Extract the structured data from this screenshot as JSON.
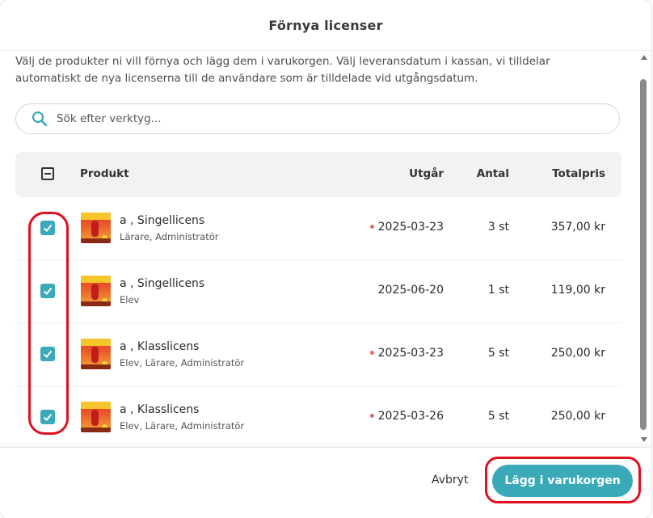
{
  "modal": {
    "title": "Förnya licenser",
    "intro": "Välj de produkter ni vill förnya och lägg dem i varukorgen. Välj leveransdatum i kassan, vi tilldelar automatiskt de nya licenserna till de användare som är tilldelade vid utgångsdatum."
  },
  "search": {
    "placeholder": "Sök efter verktyg..."
  },
  "table": {
    "headers": {
      "product": "Produkt",
      "expires": "Utgår",
      "quantity": "Antal",
      "total": "Totalpris"
    },
    "rows": [
      {
        "name": "a , Singellicens",
        "roles": "Lärare, Administratör",
        "expires": "2025-03-23",
        "expiring_soon": true,
        "quantity": "3 st",
        "price": "357,00 kr",
        "checked": true
      },
      {
        "name": "a , Singellicens",
        "roles": "Elev",
        "expires": "2025-06-20",
        "expiring_soon": false,
        "quantity": "1 st",
        "price": "119,00 kr",
        "checked": true
      },
      {
        "name": "a , Klasslicens",
        "roles": "Elev, Lärare, Administratör",
        "expires": "2025-03-23",
        "expiring_soon": true,
        "quantity": "5 st",
        "price": "250,00 kr",
        "checked": true
      },
      {
        "name": "a , Klasslicens",
        "roles": "Elev, Lärare, Administratör",
        "expires": "2025-03-26",
        "expiring_soon": true,
        "quantity": "5 st",
        "price": "250,00 kr",
        "checked": true
      }
    ]
  },
  "footer": {
    "cancel_label": "Avbryt",
    "add_label": "Lägg i varukorgen"
  },
  "colors": {
    "accent": "#3aaab8",
    "warning_dot": "#e06a6a",
    "annotation": "#e0101e"
  },
  "icons": {
    "search": "search-icon",
    "checkbox_checked": "checkmark-icon",
    "select_all": "minus-checkbox-icon"
  }
}
